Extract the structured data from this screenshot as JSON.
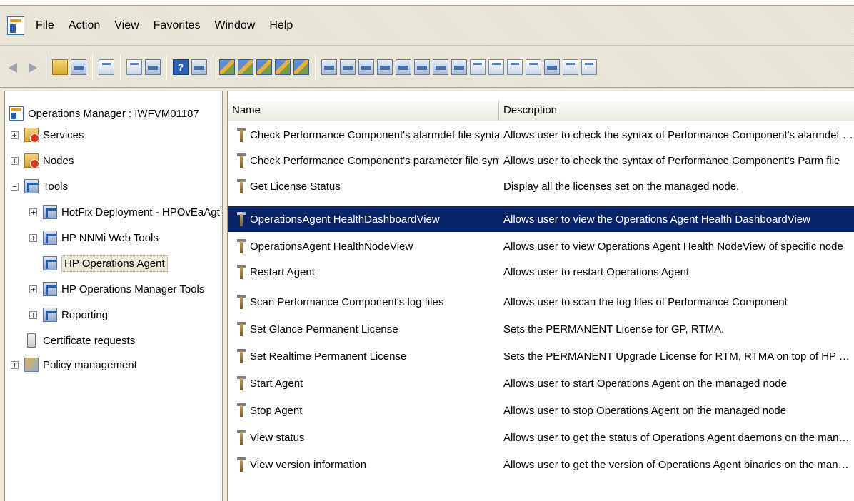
{
  "menubar": {
    "items": [
      "File",
      "Action",
      "View",
      "Favorites",
      "Window",
      "Help"
    ]
  },
  "toolbar": {
    "icons": [
      "back-arrow-icon",
      "forward-arrow-icon",
      "up-folder-icon",
      "show-hide-tree-icon",
      "copy-icon",
      "properties-icon",
      "export-list-icon",
      "help-icon",
      "console-grid-icon"
    ]
  },
  "tree": {
    "root": "Operations Manager : IWFVM01187",
    "items": [
      {
        "label": "Services",
        "expander": "+"
      },
      {
        "label": "Nodes",
        "expander": "+"
      },
      {
        "label": "Tools",
        "expander": "−"
      },
      {
        "label": "HotFix Deployment - HPOvEaAgt",
        "expander": "+"
      },
      {
        "label": "HP NNMi Web Tools",
        "expander": "+"
      },
      {
        "label": "HP Operations Agent",
        "expander": ""
      },
      {
        "label": "HP Operations Manager Tools",
        "expander": "+"
      },
      {
        "label": "Reporting",
        "expander": "+"
      },
      {
        "label": "Certificate requests",
        "expander": ""
      },
      {
        "label": "Policy management",
        "expander": "+"
      }
    ]
  },
  "list": {
    "columns": {
      "name": "Name",
      "description": "Description"
    },
    "rows": [
      {
        "name": "Check Performance Component's alarmdef file syntax",
        "description": "Allows user to check the syntax of Performance Component's alarmdef file"
      },
      {
        "name": "Check Performance Component's parameter file syntax",
        "description": "Allows user to check the syntax of Performance Component's Parm file"
      },
      {
        "name": "Get License Status",
        "description": "Display all the licenses set on the managed node."
      },
      {
        "name": "OperationsAgent HealthDashboardView",
        "description": "Allows user to view the Operations Agent Health DashboardView"
      },
      {
        "name": "OperationsAgent HealthNodeView",
        "description": "Allows user to view Operations Agent Health NodeView of specific node"
      },
      {
        "name": "Restart Agent",
        "description": "Allows user to restart Operations Agent"
      },
      {
        "name": "Scan Performance Component's log files",
        "description": "Allows user to scan the log files of Performance Component"
      },
      {
        "name": "Set Glance Permanent License",
        "description": "Sets the PERMANENT License for GP, RTMA."
      },
      {
        "name": "Set Realtime Permanent License",
        "description": "Sets the PERMANENT Upgrade License for RTM, RTMA on top of HP Operation..."
      },
      {
        "name": "Start Agent",
        "description": "Allows user to start Operations Agent on the managed node"
      },
      {
        "name": "Stop Agent",
        "description": "Allows user to stop Operations Agent on the managed node"
      },
      {
        "name": "View status",
        "description": "Allows user to get the status of Operations Agent daemons on the managed n..."
      },
      {
        "name": "View version information",
        "description": "Allows user to get the version of Operations Agent binaries on the managed n..."
      }
    ]
  },
  "colors": {
    "selection": "#0a246a",
    "chrome": "#ece9d8"
  }
}
